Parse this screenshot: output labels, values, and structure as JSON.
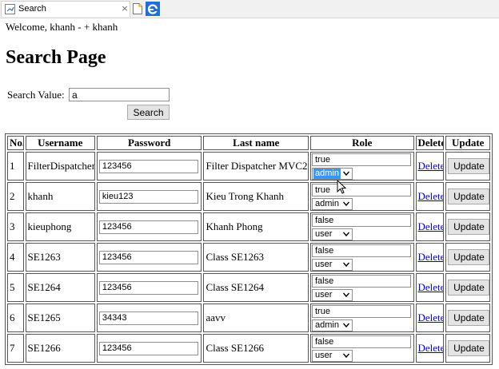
{
  "browser": {
    "tab_title": "Search",
    "tab_close": "×"
  },
  "page": {
    "welcome": "Welcome, khanh - + khanh",
    "heading": "Search Page"
  },
  "search": {
    "label": "Search Value:",
    "value": "a",
    "button": "Search"
  },
  "table": {
    "headers": [
      "No.",
      "Username",
      "Password",
      "Last name",
      "Role",
      "Delete",
      "Update"
    ],
    "delete_label": "Delete",
    "update_label": "Update",
    "rows": [
      {
        "no": "1",
        "username": "FilterDispatcher",
        "password": "123456",
        "last_name": "Filter Dispatcher MVC2",
        "role_flag": "true",
        "role": "admin"
      },
      {
        "no": "2",
        "username": "khanh",
        "password": "kieu123",
        "last_name": "Kieu Trong Khanh",
        "role_flag": "true",
        "role": "admin"
      },
      {
        "no": "3",
        "username": "kieuphong",
        "password": "123456",
        "last_name": "Khanh Phong",
        "role_flag": "false",
        "role": "user"
      },
      {
        "no": "4",
        "username": "SE1263",
        "password": "123456",
        "last_name": "Class SE1263",
        "role_flag": "false",
        "role": "user"
      },
      {
        "no": "5",
        "username": "SE1264",
        "password": "123456",
        "last_name": "Class SE1264",
        "role_flag": "false",
        "role": "user"
      },
      {
        "no": "6",
        "username": "SE1265",
        "password": "34343",
        "last_name": "aavv",
        "role_flag": "true",
        "role": "admin"
      },
      {
        "no": "7",
        "username": "SE1266",
        "password": "123456",
        "last_name": "Class SE1266",
        "role_flag": "false",
        "role": "user"
      }
    ]
  },
  "colors": {
    "link": "#0000cc",
    "selection": "#3399ff",
    "button_bg": "#e3e3e3"
  }
}
